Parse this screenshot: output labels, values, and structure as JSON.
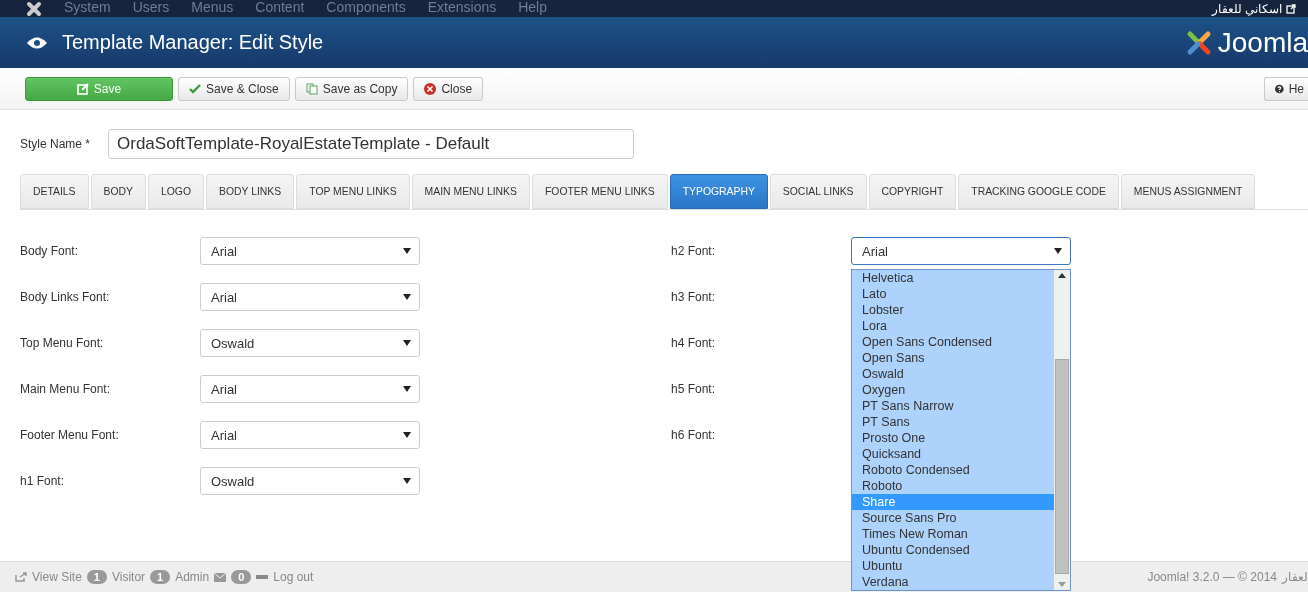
{
  "topmenu": {
    "items": [
      "System",
      "Users",
      "Menus",
      "Content",
      "Components",
      "Extensions",
      "Help"
    ],
    "site_link": "اسكاني للعقار"
  },
  "header": {
    "title": "Template Manager: Edit Style",
    "logo": "Joomla"
  },
  "toolbar": {
    "buttons": [
      {
        "label": "Save",
        "kind": "primary"
      },
      {
        "label": "Save & Close",
        "kind": "check"
      },
      {
        "label": "Save as Copy",
        "kind": "copy"
      },
      {
        "label": "Close",
        "kind": "close"
      }
    ],
    "help": "He"
  },
  "style_name": {
    "label": "Style Name *",
    "value": "OrdaSoftTemplate-RoyalEstateTemplate - Default"
  },
  "tabs": [
    {
      "label": "DETAILS",
      "selected": false
    },
    {
      "label": "BODY",
      "selected": false
    },
    {
      "label": "LOGO",
      "selected": false
    },
    {
      "label": "BODY LINKS",
      "selected": false
    },
    {
      "label": "TOP MENU LINKS",
      "selected": false
    },
    {
      "label": "MAIN MENU LINKS",
      "selected": false
    },
    {
      "label": "FOOTER MENU LINKS",
      "selected": false
    },
    {
      "label": "TYPOGRAPHY",
      "selected": true
    },
    {
      "label": "SOCIAL LINKS",
      "selected": false
    },
    {
      "label": "COPYRIGHT",
      "selected": false
    },
    {
      "label": "TRACKING GOOGLE CODE",
      "selected": false
    },
    {
      "label": "MENUS ASSIGNMENT",
      "selected": false
    }
  ],
  "left_fields": [
    {
      "label": "Body Font:",
      "value": "Arial"
    },
    {
      "label": "Body Links Font:",
      "value": "Arial"
    },
    {
      "label": "Top Menu Font:",
      "value": "Oswald"
    },
    {
      "label": "Main Menu Font:",
      "value": "Arial"
    },
    {
      "label": "Footer Menu Font:",
      "value": "Arial"
    },
    {
      "label": "h1 Font:",
      "value": "Oswald"
    }
  ],
  "right_fields": [
    {
      "label": "h2 Font:",
      "value": "Arial"
    },
    {
      "label": "h3 Font:"
    },
    {
      "label": "h4 Font:"
    },
    {
      "label": "h5 Font:"
    },
    {
      "label": "h6 Font:"
    }
  ],
  "dropdown": {
    "options": [
      {
        "label": "Helvetica",
        "selected": false
      },
      {
        "label": "Lato",
        "selected": false
      },
      {
        "label": "Lobster",
        "selected": false
      },
      {
        "label": "Lora",
        "selected": false
      },
      {
        "label": "Open Sans Condensed",
        "selected": false
      },
      {
        "label": "Open Sans",
        "selected": false
      },
      {
        "label": "Oswald",
        "selected": false
      },
      {
        "label": "Oxygen",
        "selected": false
      },
      {
        "label": "PT Sans Narrow",
        "selected": false
      },
      {
        "label": "PT Sans",
        "selected": false
      },
      {
        "label": "Prosto One",
        "selected": false
      },
      {
        "label": "Quicksand",
        "selected": false
      },
      {
        "label": "Roboto Condensed",
        "selected": false
      },
      {
        "label": "Roboto",
        "selected": false
      },
      {
        "label": "Share",
        "selected": true
      },
      {
        "label": "Source Sans Pro",
        "selected": false
      },
      {
        "label": "Times New Roman",
        "selected": false
      },
      {
        "label": "Ubuntu Condensed",
        "selected": false
      },
      {
        "label": "Ubuntu",
        "selected": false
      },
      {
        "label": "Verdana",
        "selected": false
      }
    ]
  },
  "status_bar": {
    "view_site": "View Site",
    "visitors_count": "1",
    "visitors": "Visitor",
    "admins_count": "1",
    "admins": "Admin",
    "messages_count": "0",
    "logout": "Log out",
    "version": "Joomla! 3.2.0 — © 2014",
    "site_tail": "لعقار"
  }
}
